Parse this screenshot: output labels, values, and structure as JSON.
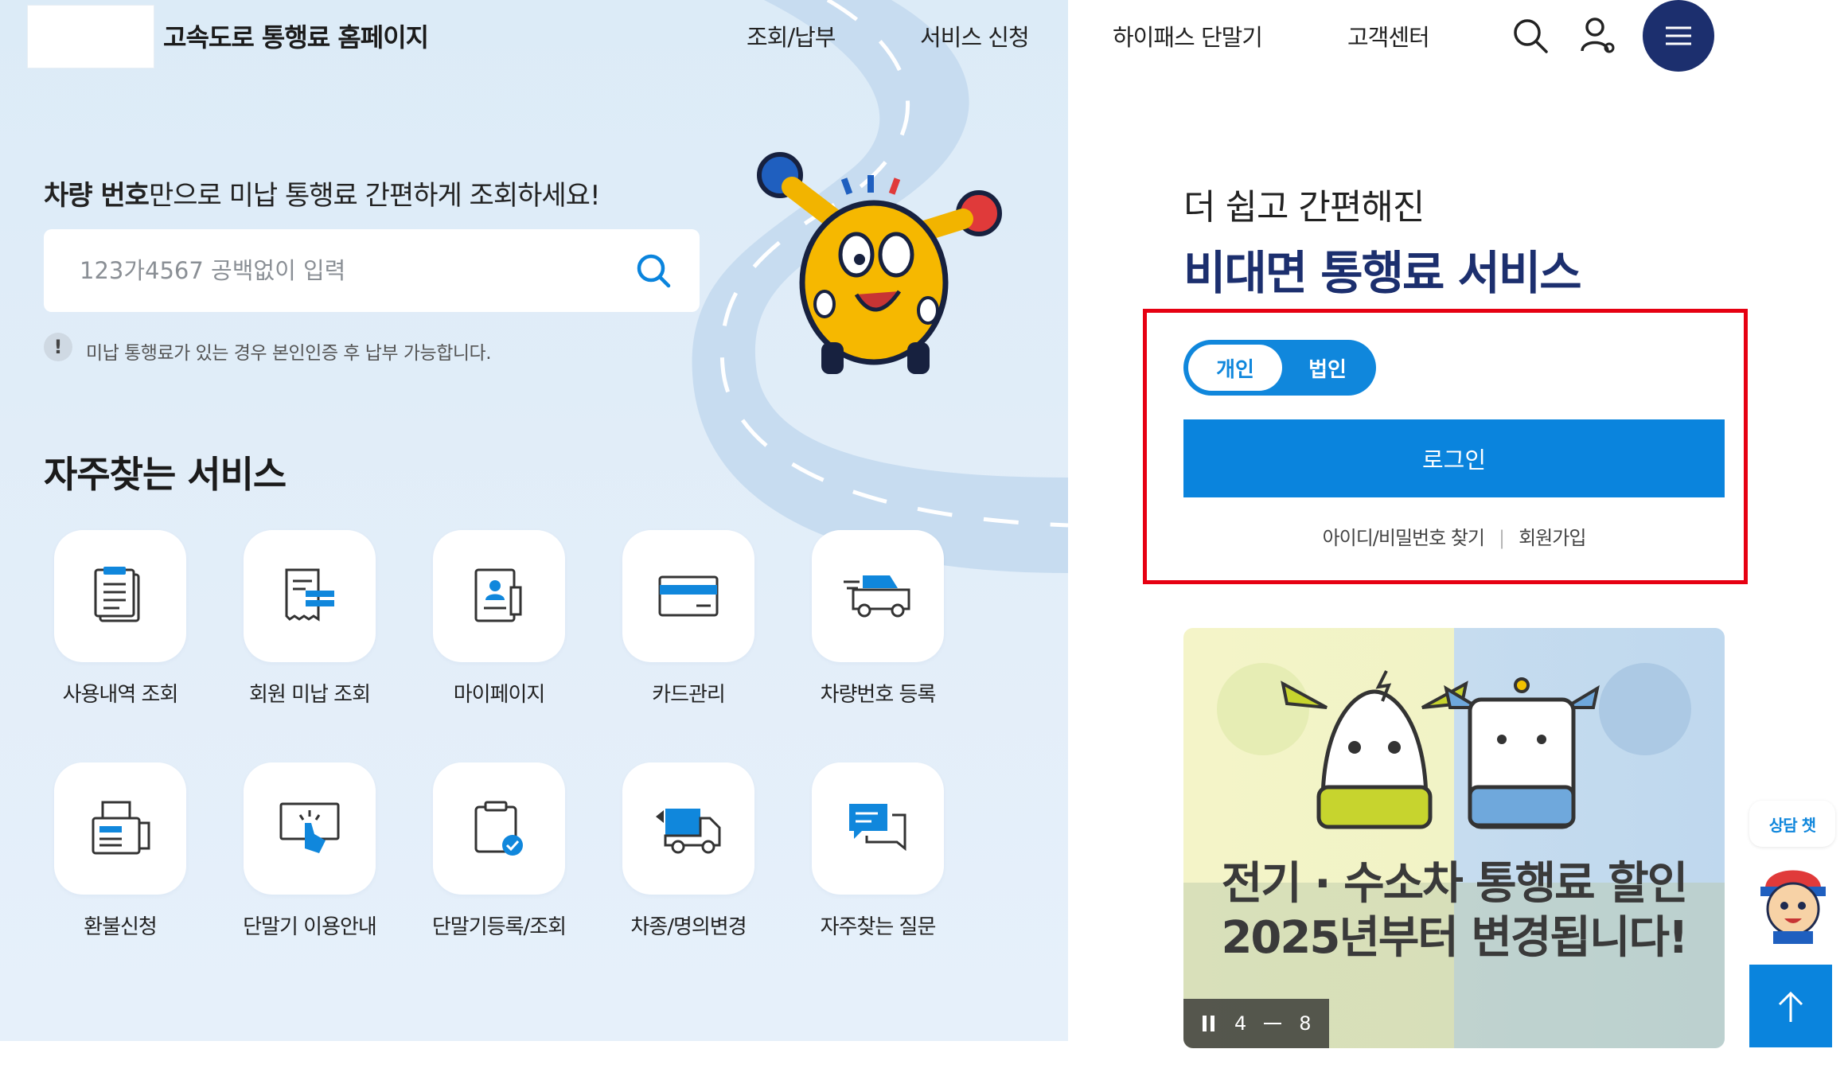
{
  "header": {
    "site_title": "고속도로 통행료 홈페이지",
    "nav": [
      "조회/납부",
      "서비스 신청",
      "하이패스 단말기",
      "고객센터"
    ],
    "icons": [
      "search-icon",
      "user-icon",
      "menu-icon"
    ]
  },
  "search": {
    "lead_bold": "차량 번호",
    "lead_rest": "만으로 미납 통행료 간편하게 조회하세요!",
    "placeholder": "123가4567 공백없이 입력",
    "notice_mark": "!",
    "notice": "미납 통행료가 있는 경우 본인인증 후 납부 가능합니다."
  },
  "faq": {
    "title": "자주찾는 서비스",
    "items": [
      {
        "label": "사용내역 조회",
        "icon": "usage-history-icon"
      },
      {
        "label": "회원 미납 조회",
        "icon": "unpaid-receipt-icon"
      },
      {
        "label": "마이페이지",
        "icon": "mypage-icon"
      },
      {
        "label": "카드관리",
        "icon": "card-icon"
      },
      {
        "label": "차량번호 등록",
        "icon": "car-icon"
      },
      {
        "label": "환불신청",
        "icon": "refund-fax-icon"
      },
      {
        "label": "단말기 이용안내",
        "icon": "touch-screen-icon"
      },
      {
        "label": "단말기등록/조회",
        "icon": "device-check-icon"
      },
      {
        "label": "차종/명의변경",
        "icon": "truck-icon"
      },
      {
        "label": "자주찾는 질문",
        "icon": "chat-icon"
      }
    ]
  },
  "right": {
    "subtitle": "더 쉽고 간편해진",
    "title": "비대면 통행료 서비스",
    "toggle_on": "개인",
    "toggle_off": "법인",
    "login": "로그인",
    "find_id": "아이디/비밀번호 찾기",
    "signup": "회원가입"
  },
  "banner": {
    "line1": "전기 · 수소차 통행료 할인",
    "line2": "2025년부터 변경됩니다!",
    "current": "4",
    "total": "8"
  },
  "floating": {
    "chat": "상담 챗"
  },
  "colors": {
    "navy": "#1c2f6e",
    "blue": "#0a84dd",
    "highlight_border": "#e60012",
    "panel_bg": "#dcebf7"
  }
}
